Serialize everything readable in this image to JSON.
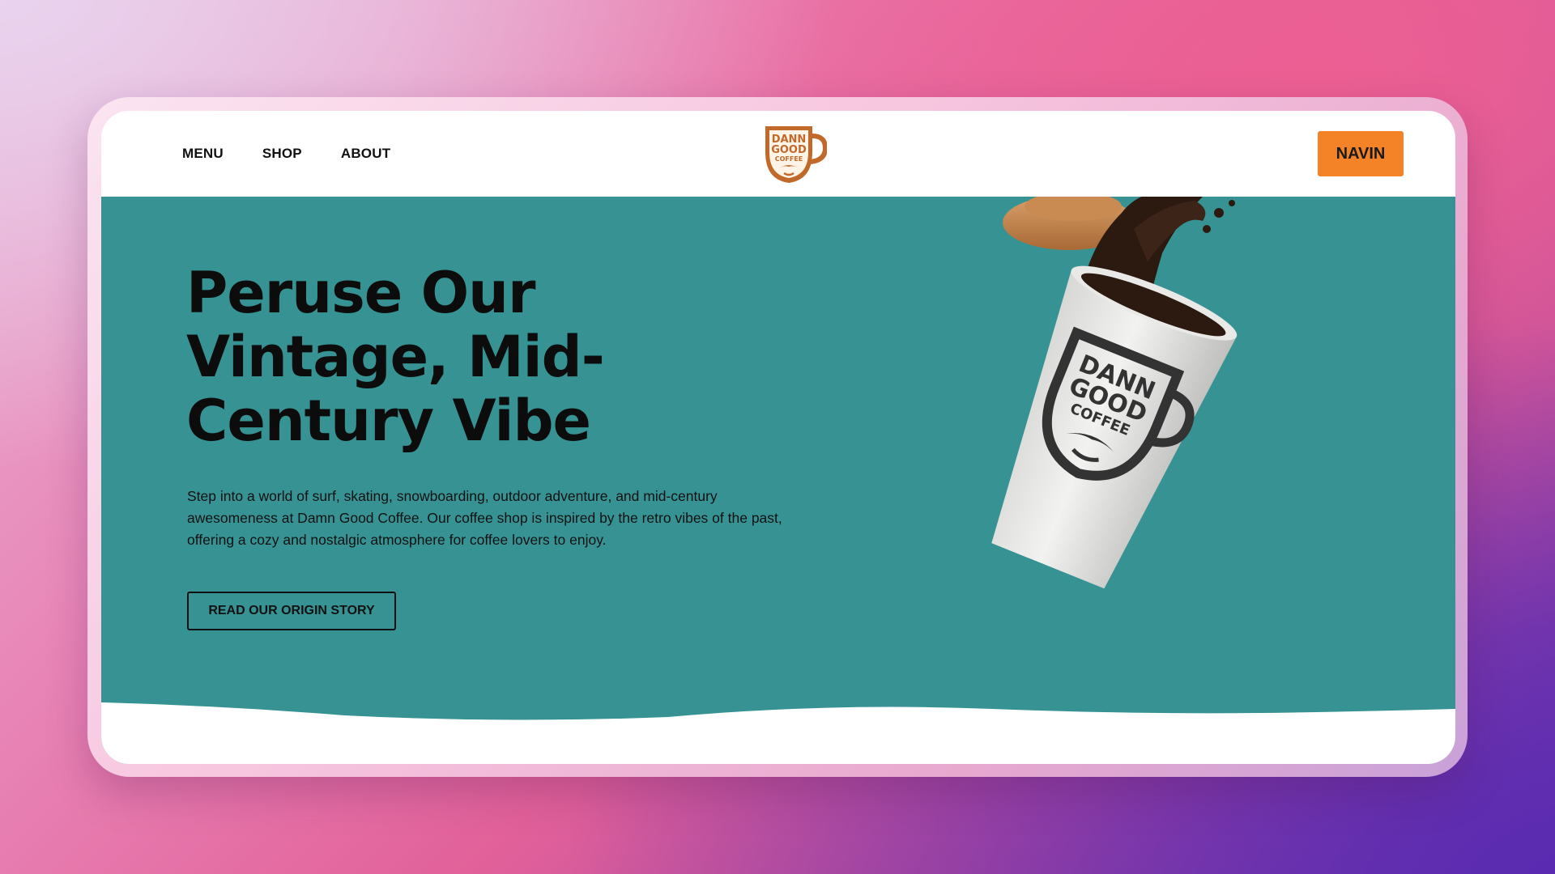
{
  "nav": {
    "links": [
      {
        "label": "MENU"
      },
      {
        "label": "SHOP"
      },
      {
        "label": "ABOUT"
      }
    ],
    "logo_text": [
      "DANN",
      "GOOD",
      "COFFEE"
    ],
    "cta_label": "NAVIN"
  },
  "hero": {
    "headline_lines": [
      "Peruse Our",
      "Vintage, Mid-",
      "Century Vibe"
    ],
    "body": "Step into a world of surf, skating, snowboarding, outdoor adventure, and mid-century awesomeness at Damn Good Coffee. Our coffee shop is inspired by the retro vibes of the past, offering a cozy and nostalgic atmosphere for coffee lovers to enjoy.",
    "button_label": "READ OUR ORIGIN STORY",
    "cup_text": [
      "DANN",
      "GOOD",
      "COFFEE"
    ]
  },
  "colors": {
    "hero_bg": "#379393",
    "accent": "#f48328",
    "logo_brown": "#c1692a",
    "text_dark": "#0c0c0c"
  },
  "icons": {
    "logo": "coffee-mug-logo",
    "illustration": "coffee-cup-splash-illustration"
  }
}
